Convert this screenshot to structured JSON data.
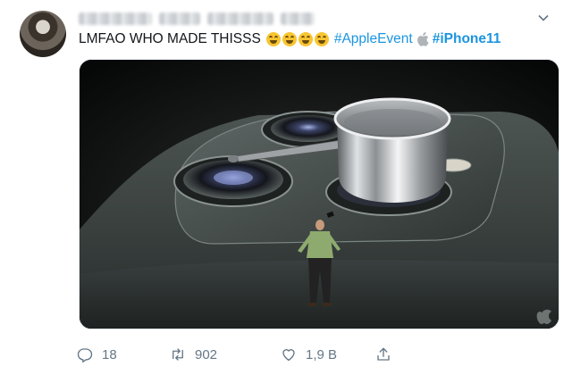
{
  "tweet": {
    "text": "LMFAO WHO MADE THISSS",
    "emoji_count": 4,
    "emoji_name": "face-with-tears-of-joy",
    "hashtag_1": "#AppleEvent",
    "hashtag_2": "#iPhone11",
    "link_color": "#1b95e0"
  },
  "actions": {
    "replies": "18",
    "retweets": "902",
    "likes": "1,9 B"
  },
  "icons": {
    "more": "chevron-down-icon",
    "reply": "reply-icon",
    "retweet": "retweet-icon",
    "like": "heart-icon",
    "share": "share-icon",
    "brand": "apple-logo-icon"
  },
  "colors": {
    "text": "#14171a",
    "secondary": "#657786"
  }
}
